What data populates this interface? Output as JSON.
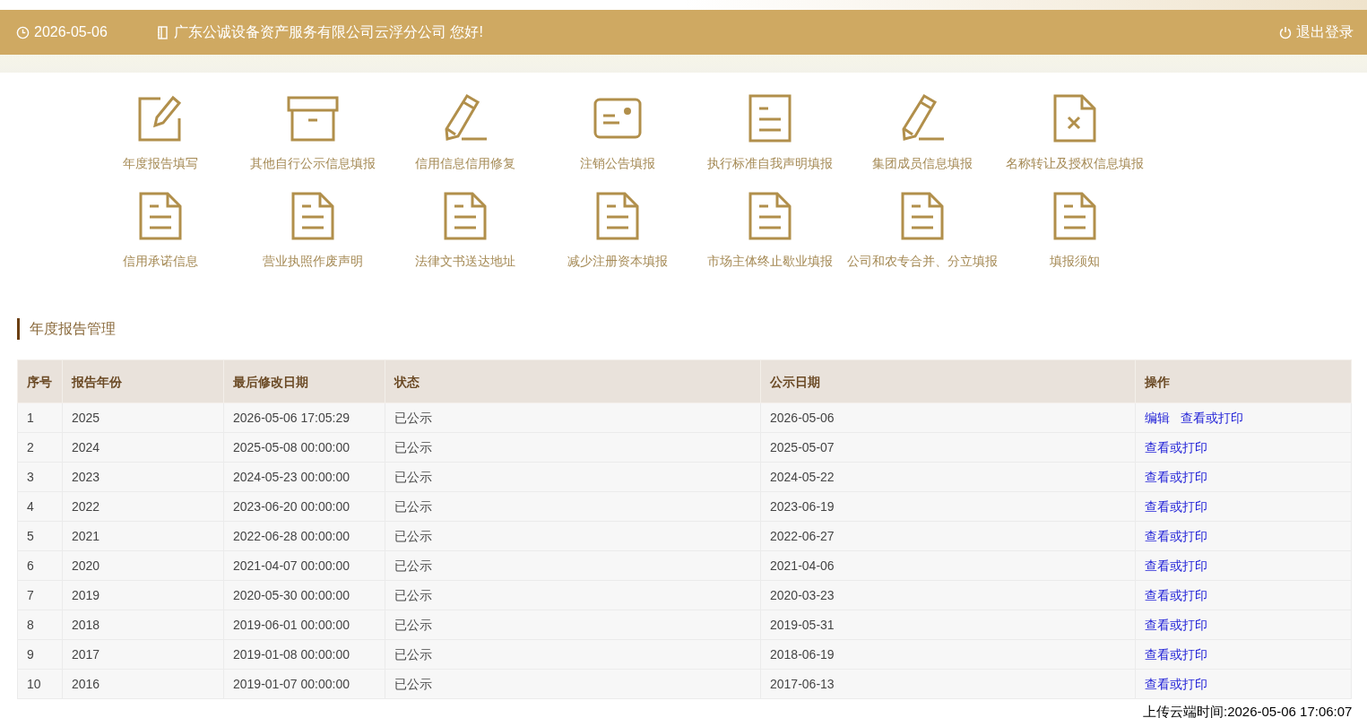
{
  "header": {
    "date": "2026-05-06",
    "greeting": "广东公诚设备资产服务有限公司云浮分公司 您好!",
    "logout": "退出登录"
  },
  "shortcuts": [
    {
      "kind": "edit",
      "label": "年度报告填写"
    },
    {
      "kind": "box",
      "label": "其他自行公示信息填报"
    },
    {
      "kind": "pencil",
      "label": "信用信息信用修复"
    },
    {
      "kind": "card",
      "label": "注销公告填报"
    },
    {
      "kind": "doc",
      "label": "执行标准自我声明填报"
    },
    {
      "kind": "pencil",
      "label": "集团成员信息填报"
    },
    {
      "kind": "doc-x",
      "label": "名称转让及授权信息填报"
    },
    {
      "kind": "doc-fold",
      "label": "信用承诺信息"
    },
    {
      "kind": "doc-fold",
      "label": "营业执照作废声明"
    },
    {
      "kind": "doc-fold",
      "label": "法律文书送达地址"
    },
    {
      "kind": "doc-fold",
      "label": "减少注册资本填报"
    },
    {
      "kind": "doc-fold",
      "label": "市场主体终止歇业填报"
    },
    {
      "kind": "doc-fold",
      "label": "公司和农专合并、分立填报"
    },
    {
      "kind": "doc-fold",
      "label": "填报须知"
    }
  ],
  "section_title": "年度报告管理",
  "table": {
    "columns": [
      "序号",
      "报告年份",
      "最后修改日期",
      "状态",
      "公示日期",
      "操作"
    ],
    "rows": [
      {
        "cells": [
          "1",
          "2025",
          "2026-05-06 17:05:29",
          "已公示",
          "2026-05-06"
        ],
        "actions": [
          "编辑",
          "查看或打印"
        ]
      },
      {
        "cells": [
          "2",
          "2024",
          "2025-05-08 00:00:00",
          "已公示",
          "2025-05-07"
        ],
        "actions": [
          "查看或打印"
        ]
      },
      {
        "cells": [
          "3",
          "2023",
          "2024-05-23 00:00:00",
          "已公示",
          "2024-05-22"
        ],
        "actions": [
          "查看或打印"
        ]
      },
      {
        "cells": [
          "4",
          "2022",
          "2023-06-20 00:00:00",
          "已公示",
          "2023-06-19"
        ],
        "actions": [
          "查看或打印"
        ]
      },
      {
        "cells": [
          "5",
          "2021",
          "2022-06-28 00:00:00",
          "已公示",
          "2022-06-27"
        ],
        "actions": [
          "查看或打印"
        ]
      },
      {
        "cells": [
          "6",
          "2020",
          "2021-04-07 00:00:00",
          "已公示",
          "2021-04-06"
        ],
        "actions": [
          "查看或打印"
        ]
      },
      {
        "cells": [
          "7",
          "2019",
          "2020-05-30 00:00:00",
          "已公示",
          "2020-03-23"
        ],
        "actions": [
          "查看或打印"
        ]
      },
      {
        "cells": [
          "8",
          "2018",
          "2019-06-01 00:00:00",
          "已公示",
          "2019-05-31"
        ],
        "actions": [
          "查看或打印"
        ]
      },
      {
        "cells": [
          "9",
          "2017",
          "2019-01-08 00:00:00",
          "已公示",
          "2018-06-19"
        ],
        "actions": [
          "查看或打印"
        ]
      },
      {
        "cells": [
          "10",
          "2016",
          "2019-01-07 00:00:00",
          "已公示",
          "2017-06-13"
        ],
        "actions": [
          "查看或打印"
        ]
      }
    ]
  },
  "upload_time": "上传云端时间:2026-05-06 17:06:07"
}
